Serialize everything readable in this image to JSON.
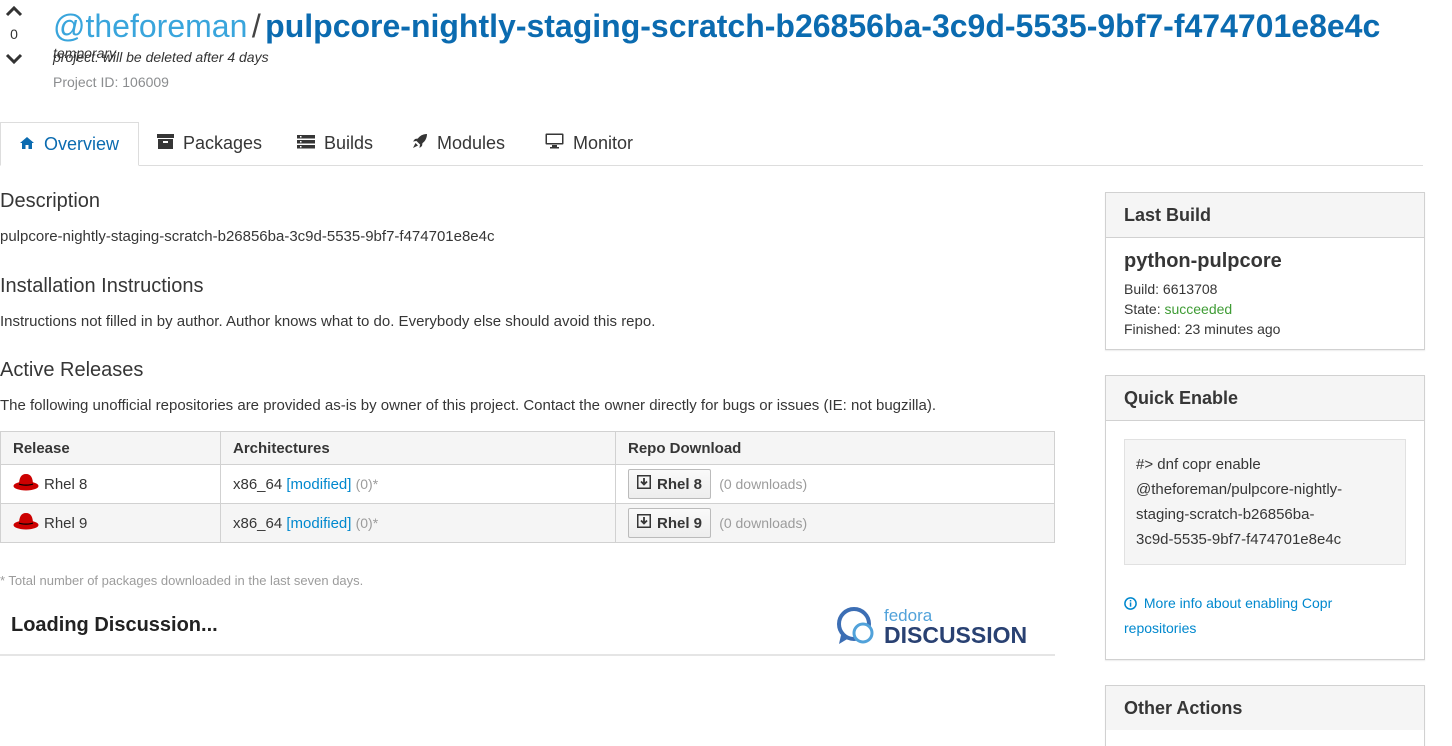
{
  "vote": {
    "count": "0"
  },
  "header": {
    "owner": "@theforeman",
    "separator": "/",
    "project": "pulpcore-nightly-staging-scratch-b26856ba-3c9d-5535-9bf7-f474701e8e4c",
    "temp_prefix": "temporary",
    "temp_note": "project: will be deleted after 4 days",
    "project_id": "Project ID: 106009"
  },
  "tabs": [
    {
      "label": "Overview",
      "icon": "home-icon",
      "active": true
    },
    {
      "label": "Packages",
      "icon": "archive-icon"
    },
    {
      "label": "Builds",
      "icon": "list-icon"
    },
    {
      "label": "Modules",
      "icon": "rocket-icon"
    },
    {
      "label": "Monitor",
      "icon": "desktop-icon"
    }
  ],
  "description": {
    "heading": "Description",
    "text": "pulpcore-nightly-staging-scratch-b26856ba-3c9d-5535-9bf7-f474701e8e4c"
  },
  "installation": {
    "heading": "Installation Instructions",
    "text": "Instructions not filled in by author. Author knows what to do. Everybody else should avoid this repo."
  },
  "releases": {
    "heading": "Active Releases",
    "intro": "The following unofficial repositories are provided as-is by owner of this project. Contact the owner directly for bugs or issues (IE: not bugzilla).",
    "columns": [
      "Release",
      "Architectures",
      "Repo Download"
    ],
    "rows": [
      {
        "release": "Rhel 8",
        "arch": "x86_64",
        "modified": "[modified]",
        "count": "(0)*",
        "button": "Rhel 8",
        "downloads": "(0 downloads)"
      },
      {
        "release": "Rhel 9",
        "arch": "x86_64",
        "modified": "[modified]",
        "count": "(0)*",
        "button": "Rhel 9",
        "downloads": "(0 downloads)"
      }
    ],
    "footnote": "* Total number of packages downloaded in the last seven days."
  },
  "discussion": {
    "loading": "Loading Discussion...",
    "logo_small": "fedora",
    "logo_big": "DISCUSSION"
  },
  "sidebar": {
    "last_build": {
      "title": "Last Build",
      "package": "python-pulpcore",
      "build_label": "Build:",
      "build_id": "6613708",
      "state_label": "State:",
      "state": "succeeded",
      "finished_label": "Finished:",
      "finished": "23 minutes ago"
    },
    "quick_enable": {
      "title": "Quick Enable",
      "command_lines": [
        "#> dnf copr enable",
        "@theforeman/pulpcore-nightly-",
        "staging-scratch-b26856ba-",
        "3c9d-5535-9bf7-f474701e8e4c"
      ],
      "more_info_1": "More info about enabling Copr",
      "more_info_2": "repositories"
    },
    "other_actions": {
      "title": "Other Actions"
    }
  },
  "colors": {
    "owner": "#39a5dc",
    "project": "#0b6bb0",
    "link": "#0088ce",
    "success": "#3f9c35",
    "redhat": "#cc0000"
  }
}
